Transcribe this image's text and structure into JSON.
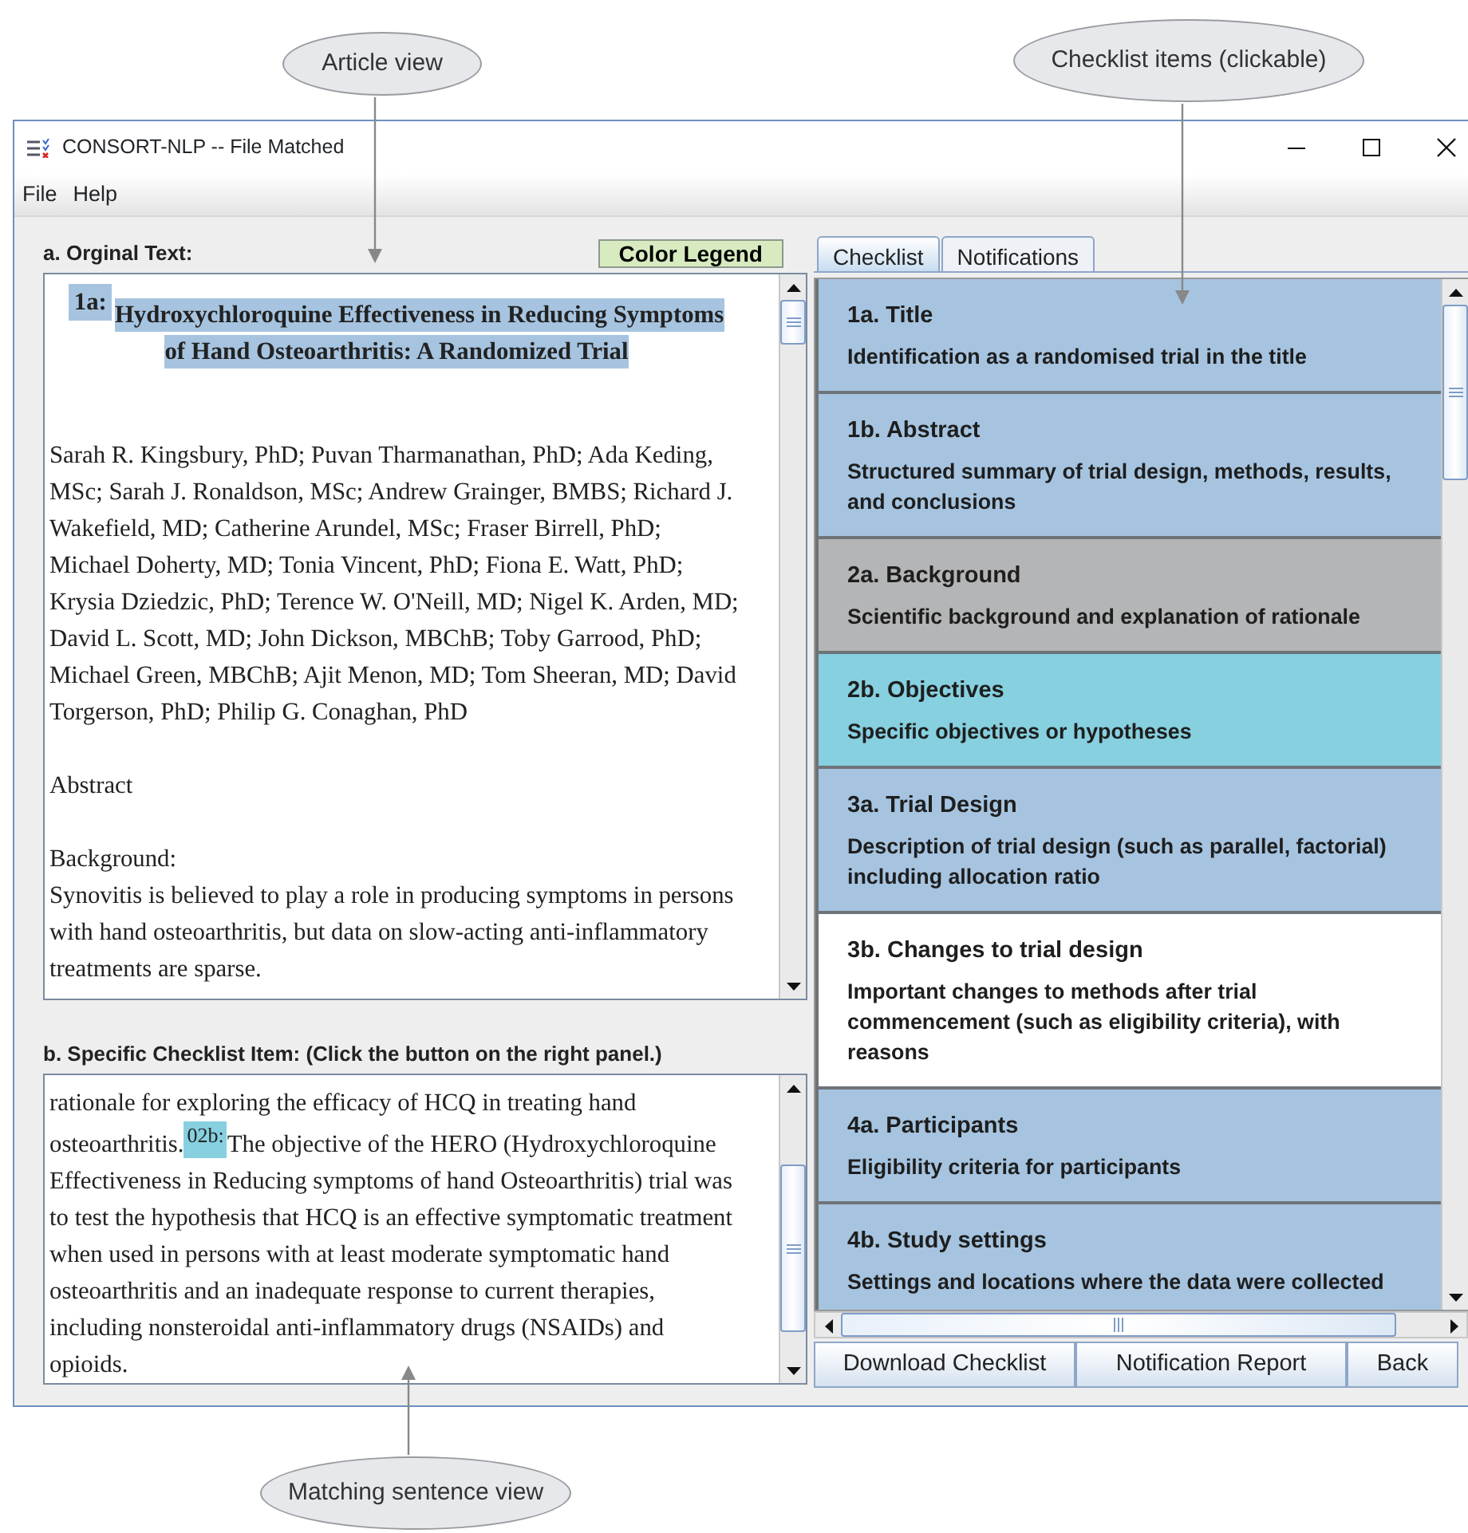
{
  "callouts": [
    {
      "text": "Article view"
    },
    {
      "text": "Checklist items (clickable)"
    },
    {
      "text": "Matching sentence view"
    }
  ],
  "window": {
    "title": "CONSORT-NLP -- File Matched"
  },
  "menu": [
    "File",
    "Help"
  ],
  "article": {
    "label": "a. Orginal Text:",
    "legend_button": "Color Legend",
    "title_tag": {
      "text": "1a:",
      "color": "#a6c4e0"
    },
    "title_lines": [
      "Hydroxychloroquine Effectiveness in Reducing Symptoms",
      "of Hand Osteoarthritis: A Randomized Trial"
    ],
    "sections": [
      {
        "text": "Sarah R. Kingsbury, PhD; Puvan Tharmanathan, PhD; Ada Keding, MSc; Sarah J. Ronaldson, MSc; Andrew Grainger, BMBS; Richard J. Wakefield, MD; Catherine Arundel, MSc; Fraser Birrell, PhD; Michael Doherty, MD; Tonia Vincent, PhD; Fiona E. Watt, PhD; Krysia Dziedzic, PhD; Terence W. O'Neill, MD; Nigel K. Arden, MD; David L. Scott, MD; John Dickson, MBChB; Toby Garrood, PhD; Michael Green, MBChB; Ajit Menon, MD; Tom Sheeran, MD; David Torgerson, PhD; Philip G. Conaghan, PhD"
      },
      {
        "text": "Abstract"
      },
      {
        "heading": "Background:",
        "text": "Synovitis is believed to play a role in producing symptoms in persons with hand osteoarthritis, but data on slow-acting anti-inflammatory treatments are sparse."
      }
    ]
  },
  "matching": {
    "label": "b. Specific Checklist Item: (Click the button on the right panel.)",
    "before": "rationale for exploring the efficacy of HCQ in treating hand osteoarthritis.",
    "tag": {
      "text": "02b:",
      "color": "#86d0e0"
    },
    "after": "The objective of the HERO (Hydroxychloroquine Effectiveness in Reducing symptoms of hand Osteoarthritis) trial was to test the hypothesis that HCQ is an effective symptomatic treatment when used in persons with at least moderate symptomatic hand osteoarthritis and an inadequate response to current therapies, including nonsteroidal anti-inflammatory drugs (NSAIDs) and opioids."
  },
  "tabs": [
    {
      "label": "Checklist",
      "selected": true
    },
    {
      "label": "Notifications",
      "selected": false
    }
  ],
  "checklist": [
    {
      "title": "1a. Title",
      "description": "Identification as a randomised trial in the title",
      "color": "#a6c4e0"
    },
    {
      "title": "1b. Abstract",
      "description": "Structured summary of trial design, methods, results, and conclusions",
      "color": "#a6c4e0"
    },
    {
      "title": "2a. Background",
      "description": "Scientific background and explanation of rationale",
      "color": "#b4b5b6"
    },
    {
      "title": "2b. Objectives",
      "description": "Specific objectives or hypotheses",
      "color": "#86d0e0"
    },
    {
      "title": "3a. Trial Design",
      "description": "Description of trial design (such as parallel, factorial) including allocation ratio",
      "color": "#a6c4e0"
    },
    {
      "title": "3b. Changes to trial design",
      "description": "Important changes to methods after trial commencement (such as eligibility criteria), with reasons",
      "color": "#ffffff"
    },
    {
      "title": "4a. Participants",
      "description": "Eligibility criteria for participants",
      "color": "#a6c4e0"
    },
    {
      "title": "4b. Study settings",
      "description": "Settings and locations where the data were collected",
      "color": "#a6c4e0"
    }
  ],
  "buttons": [
    "Download Checklist",
    "Notification Report",
    "Back"
  ]
}
